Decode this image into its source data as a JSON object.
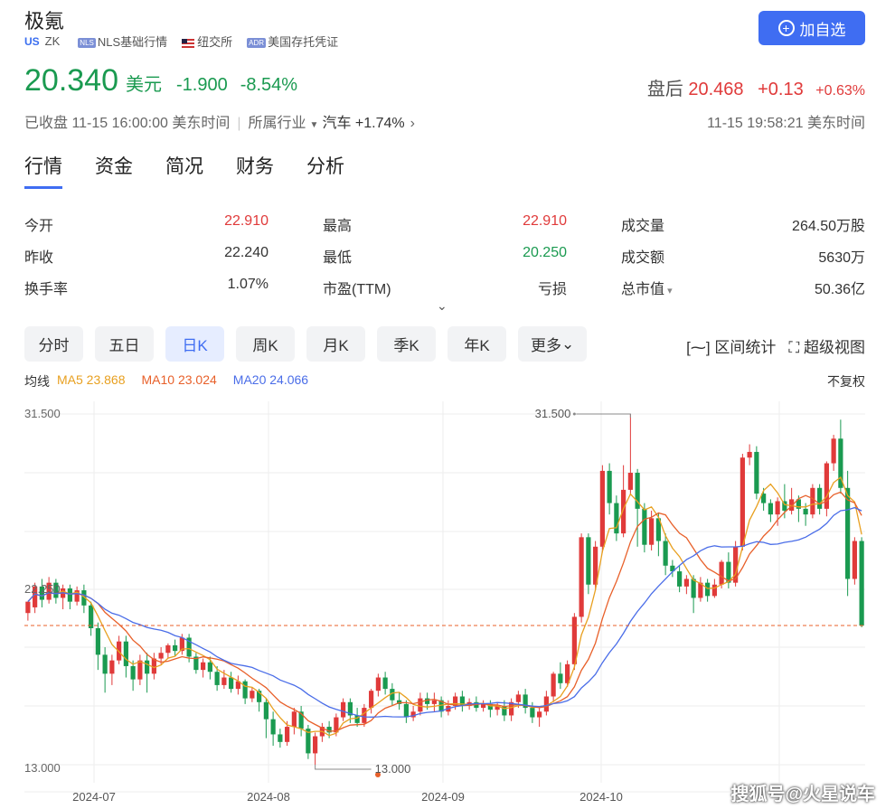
{
  "header": {
    "name": "极氪",
    "market": "US",
    "ticker": "ZK",
    "tag1_badge": "NLS",
    "tag1": "NLS基础行情",
    "tag2": "纽交所",
    "tag3_badge": "ADR",
    "tag3": "美国存托凭证",
    "add_button": "加自选"
  },
  "quote": {
    "price": "20.340",
    "currency": "美元",
    "change": "-1.900",
    "change_pct": "-8.54%",
    "after_label": "盘后",
    "after_price": "20.468",
    "after_change": "+0.13",
    "after_pct": "+0.63%",
    "status": "已收盘 11-15 16:00:00 美东时间",
    "industry_label": "所属行业",
    "industry": "汽车 +1.74%",
    "after_time": "11-15 19:58:21 美东时间"
  },
  "tabs": [
    "行情",
    "资金",
    "简况",
    "财务",
    "分析"
  ],
  "stats": [
    [
      {
        "k": "今开",
        "v": "22.910",
        "c": "red"
      },
      {
        "k": "最高",
        "v": "22.910",
        "c": "red"
      },
      {
        "k": "成交量",
        "v": "264.50万股",
        "c": ""
      }
    ],
    [
      {
        "k": "昨收",
        "v": "22.240",
        "c": ""
      },
      {
        "k": "最低",
        "v": "20.250",
        "c": "grn"
      },
      {
        "k": "成交额",
        "v": "5630万",
        "c": ""
      }
    ],
    [
      {
        "k": "换手率",
        "v": "1.07%",
        "c": ""
      },
      {
        "k": "市盈(TTM)",
        "v": "亏损",
        "c": ""
      },
      {
        "k": "总市值",
        "v": "50.36亿",
        "c": ""
      }
    ]
  ],
  "ktabs": [
    "分时",
    "五日",
    "日K",
    "周K",
    "月K",
    "季K",
    "年K",
    "更多"
  ],
  "tools": {
    "range": "区间统计",
    "fullscreen": "超级视图"
  },
  "ma": {
    "label": "均线",
    "ma5": "MA5 23.868",
    "ma10": "MA10 23.024",
    "ma20": "MA20 24.066"
  },
  "adjust": "不复权",
  "colors": {
    "up": "#e03a3a",
    "down": "#1a9a50",
    "accent": "#3f6df2",
    "ma5": "#e8a020",
    "ma10": "#e8602a",
    "ma20": "#4a6de8"
  },
  "watermark": "搜狐号@火星说车",
  "chart_data": {
    "type": "candlestick",
    "y_labels": [
      "31.500",
      "22.250",
      "13.000"
    ],
    "ylim": [
      13.0,
      31.5
    ],
    "x_labels": [
      "2024-07",
      "2024-08",
      "2024-09",
      "2024-10"
    ],
    "max_annotation": "31.500",
    "min_annotation": "13.000",
    "last_close": 20.34,
    "candles": [
      [
        21.0,
        21.6,
        21.3,
        20.6
      ],
      [
        21.3,
        22.4,
        22.6,
        21.0
      ],
      [
        22.4,
        21.7,
        22.8,
        21.3
      ],
      [
        21.7,
        22.6,
        22.9,
        21.5
      ],
      [
        22.6,
        21.8,
        22.8,
        21.5
      ],
      [
        21.8,
        22.3,
        22.5,
        21.2
      ],
      [
        22.3,
        21.6,
        22.5,
        21.2
      ],
      [
        21.6,
        22.2,
        22.4,
        21.4
      ],
      [
        22.2,
        21.4,
        22.5,
        21.0
      ],
      [
        21.4,
        20.2,
        21.6,
        19.8
      ],
      [
        20.2,
        18.8,
        20.5,
        18.0
      ],
      [
        18.8,
        17.8,
        19.2,
        16.8
      ],
      [
        17.8,
        18.5,
        18.8,
        17.2
      ],
      [
        18.5,
        19.5,
        19.8,
        18.3
      ],
      [
        19.5,
        18.2,
        19.8,
        17.6
      ],
      [
        18.2,
        17.5,
        18.5,
        16.9
      ],
      [
        17.5,
        18.5,
        18.8,
        17.2
      ],
      [
        18.5,
        17.8,
        18.9,
        16.8
      ],
      [
        17.8,
        18.6,
        18.9,
        17.5
      ],
      [
        18.6,
        18.9,
        19.2,
        18.3
      ],
      [
        18.9,
        19.3,
        19.4,
        18.6
      ],
      [
        19.3,
        19.0,
        19.6,
        18.7
      ],
      [
        19.0,
        19.7,
        19.9,
        18.8
      ],
      [
        19.7,
        18.7,
        19.9,
        18.4
      ],
      [
        18.7,
        18.0,
        18.9,
        17.8
      ],
      [
        18.0,
        18.4,
        18.6,
        17.6
      ],
      [
        18.4,
        17.9,
        18.7,
        17.5
      ],
      [
        17.9,
        17.2,
        18.2,
        16.9
      ],
      [
        17.2,
        17.6,
        18.0,
        17.0
      ],
      [
        17.6,
        17.0,
        17.9,
        16.8
      ],
      [
        17.0,
        17.4,
        17.7,
        16.7
      ],
      [
        17.4,
        16.5,
        17.5,
        16.2
      ],
      [
        16.5,
        16.9,
        17.1,
        16.3
      ],
      [
        16.9,
        16.3,
        17.0,
        15.8
      ],
      [
        16.3,
        15.4,
        16.5,
        14.4
      ],
      [
        15.4,
        14.6,
        15.8,
        14.0
      ],
      [
        14.6,
        14.2,
        14.9,
        13.9
      ],
      [
        14.2,
        15.0,
        15.3,
        14.0
      ],
      [
        15.0,
        15.8,
        16.0,
        14.6
      ],
      [
        15.8,
        14.9,
        16.1,
        14.5
      ],
      [
        14.9,
        13.6,
        15.1,
        13.3
      ],
      [
        13.6,
        14.5,
        14.7,
        13.0
      ],
      [
        14.5,
        15.0,
        15.2,
        14.2
      ],
      [
        15.0,
        14.7,
        15.3,
        14.4
      ],
      [
        14.7,
        15.5,
        15.7,
        14.5
      ],
      [
        15.5,
        16.3,
        16.5,
        15.3
      ],
      [
        16.3,
        15.6,
        16.5,
        15.2
      ],
      [
        15.6,
        15.2,
        16.0,
        15.0
      ],
      [
        15.2,
        16.0,
        16.2,
        15.0
      ],
      [
        16.0,
        16.9,
        17.0,
        15.7
      ],
      [
        16.9,
        17.6,
        17.8,
        16.6
      ],
      [
        17.6,
        17.0,
        17.9,
        16.7
      ],
      [
        17.0,
        16.4,
        17.3,
        16.1
      ],
      [
        16.4,
        16.2,
        16.8,
        15.9
      ],
      [
        16.2,
        15.5,
        16.4,
        15.2
      ],
      [
        15.5,
        15.8,
        16.1,
        15.3
      ],
      [
        15.8,
        16.5,
        16.8,
        15.6
      ],
      [
        16.5,
        16.2,
        16.8,
        15.9
      ],
      [
        16.2,
        16.4,
        16.8,
        15.8
      ],
      [
        16.4,
        15.8,
        16.6,
        15.5
      ],
      [
        15.8,
        16.1,
        16.4,
        15.6
      ],
      [
        16.1,
        16.6,
        16.8,
        15.9
      ],
      [
        16.6,
        16.1,
        16.9,
        15.8
      ],
      [
        16.1,
        16.3,
        16.5,
        15.9
      ],
      [
        16.3,
        16.0,
        16.6,
        15.8
      ],
      [
        16.0,
        16.2,
        16.4,
        15.8
      ],
      [
        16.2,
        15.9,
        16.4,
        15.5
      ],
      [
        15.9,
        16.1,
        16.3,
        15.6
      ],
      [
        16.1,
        15.6,
        16.4,
        15.3
      ],
      [
        15.6,
        16.3,
        16.5,
        15.3
      ],
      [
        16.3,
        16.7,
        16.9,
        16.0
      ],
      [
        16.7,
        16.0,
        17.0,
        15.7
      ],
      [
        16.0,
        15.5,
        16.3,
        15.2
      ],
      [
        15.5,
        15.8,
        16.0,
        15.0
      ],
      [
        15.8,
        16.6,
        16.9,
        15.6
      ],
      [
        16.6,
        17.8,
        17.9,
        16.3
      ],
      [
        17.8,
        17.3,
        18.4,
        17.0
      ],
      [
        17.3,
        18.3,
        18.5,
        17.1
      ],
      [
        18.3,
        20.8,
        21.0,
        18.0
      ],
      [
        20.8,
        25.0,
        25.2,
        20.5
      ],
      [
        25.0,
        22.5,
        25.2,
        22.0
      ],
      [
        22.5,
        24.5,
        24.8,
        22.2
      ],
      [
        24.5,
        28.5,
        28.8,
        24.2
      ],
      [
        28.5,
        26.8,
        28.9,
        26.2
      ],
      [
        26.8,
        25.2,
        27.2,
        24.8
      ],
      [
        25.2,
        27.5,
        28.8,
        25.0
      ],
      [
        27.5,
        28.4,
        31.5,
        27.2
      ],
      [
        28.4,
        26.5,
        28.6,
        24.5
      ],
      [
        26.5,
        24.6,
        26.8,
        24.2
      ],
      [
        24.6,
        26.0,
        26.4,
        24.3
      ],
      [
        26.0,
        24.8,
        26.3,
        24.0
      ],
      [
        24.8,
        23.5,
        25.2,
        23.0
      ],
      [
        23.5,
        23.2,
        23.8,
        22.9
      ],
      [
        23.2,
        22.4,
        23.5,
        22.1
      ],
      [
        22.4,
        22.8,
        23.0,
        22.0
      ],
      [
        22.8,
        21.8,
        23.0,
        21.0
      ],
      [
        21.8,
        22.6,
        22.9,
        21.6
      ],
      [
        22.6,
        21.9,
        22.8,
        21.6
      ],
      [
        21.9,
        22.5,
        22.8,
        21.8
      ],
      [
        22.5,
        23.7,
        23.8,
        22.3
      ],
      [
        23.7,
        22.6,
        24.2,
        22.3
      ],
      [
        22.6,
        24.5,
        24.8,
        22.4
      ],
      [
        24.5,
        29.2,
        29.4,
        24.3
      ],
      [
        29.2,
        29.5,
        29.9,
        28.8
      ],
      [
        29.5,
        27.3,
        29.8,
        27.0
      ],
      [
        27.3,
        26.8,
        27.6,
        26.4
      ],
      [
        26.8,
        26.2,
        27.0,
        25.8
      ],
      [
        26.2,
        26.9,
        27.1,
        25.6
      ],
      [
        26.9,
        26.4,
        27.8,
        26.0
      ],
      [
        26.4,
        27.0,
        27.6,
        26.2
      ],
      [
        27.0,
        26.5,
        27.2,
        25.8
      ],
      [
        26.5,
        26.2,
        26.8,
        25.6
      ],
      [
        26.2,
        27.6,
        27.8,
        26.0
      ],
      [
        27.6,
        26.5,
        27.8,
        26.2
      ],
      [
        26.5,
        28.9,
        29.0,
        26.1
      ],
      [
        28.9,
        30.2,
        30.4,
        28.5
      ],
      [
        30.2,
        27.6,
        31.2,
        27.3
      ],
      [
        27.6,
        22.8,
        28.5,
        21.9
      ],
      [
        22.8,
        24.8,
        25.0,
        22.5
      ],
      [
        24.8,
        20.34,
        25.0,
        20.25
      ]
    ]
  }
}
